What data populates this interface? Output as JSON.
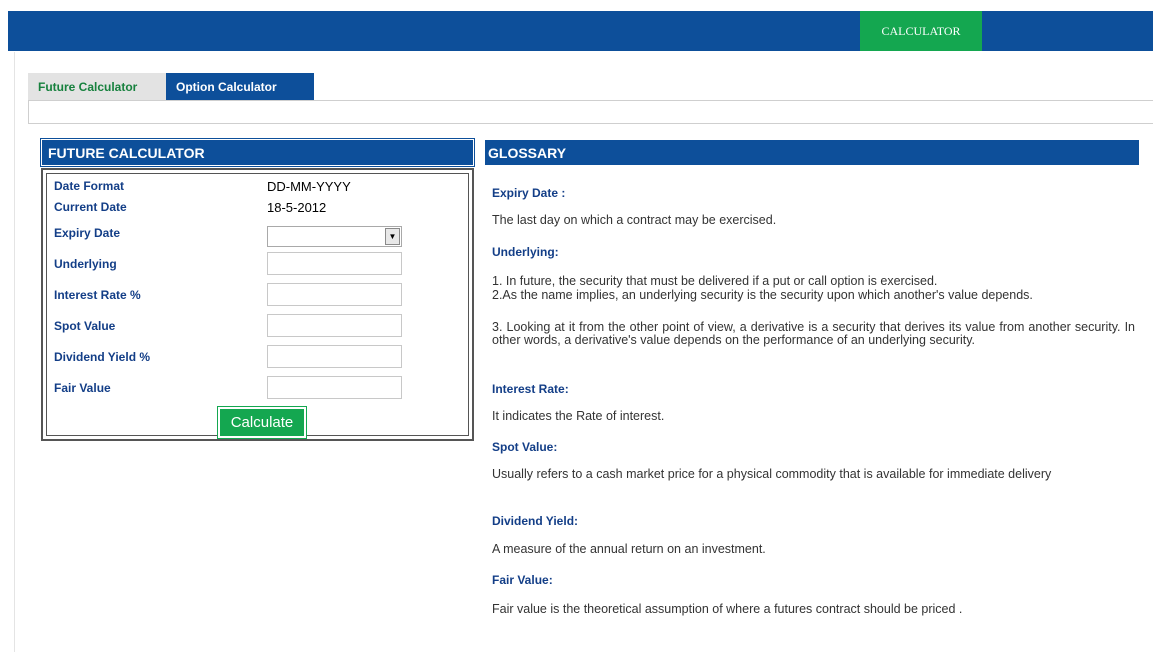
{
  "header": {
    "nav_tab": "CALCULATOR"
  },
  "tabs": [
    {
      "label": "Future Calculator"
    },
    {
      "label": "Option Calculator"
    }
  ],
  "calculator": {
    "title": "FUTURE CALCULATOR",
    "date_format_label": "Date Format",
    "date_format_value": "DD-MM-YYYY",
    "current_date_label": "Current Date",
    "current_date_value": "18-5-2012",
    "expiry_date_label": "Expiry Date",
    "expiry_date_value": "",
    "underlying_label": "Underlying",
    "underlying_value": "",
    "interest_rate_label": "Interest Rate %",
    "interest_rate_value": "",
    "spot_value_label": "Spot Value",
    "spot_value_value": "",
    "dividend_yield_label": "Dividend Yield %",
    "dividend_yield_value": "",
    "fair_value_label": "Fair Value",
    "fair_value_value": "",
    "calculate_label": "Calculate"
  },
  "glossary": {
    "title": "GLOSSARY",
    "expiry": {
      "term": "Expiry Date :",
      "def": "The last day on which a contract may be exercised."
    },
    "underlying": {
      "term": "Underlying:",
      "def1": "1. In future, the security that must be delivered if a put or call option is exercised.",
      "def2": "2.As the name implies, an underlying security is the security upon which another's value depends.",
      "def3": "3. Looking at it from the other point of view, a derivative is a security that derives its value from another security. In other words, a derivative's value depends on the performance of an underlying security."
    },
    "interest": {
      "term": "Interest Rate:",
      "def": "It indicates the Rate of interest."
    },
    "spot": {
      "term": "Spot Value:",
      "def": "Usually refers to a cash market price for a physical commodity that is available for immediate delivery"
    },
    "dividend": {
      "term": "Dividend Yield:",
      "def": "A measure of the annual return on an investment."
    },
    "fair": {
      "term": "Fair Value:",
      "def": "Fair value is the theoretical assumption of where a futures contract should be priced ."
    }
  },
  "colors": {
    "brand_blue": "#0d4f9a",
    "accent_green": "#14a750",
    "label_blue": "#133e87"
  }
}
